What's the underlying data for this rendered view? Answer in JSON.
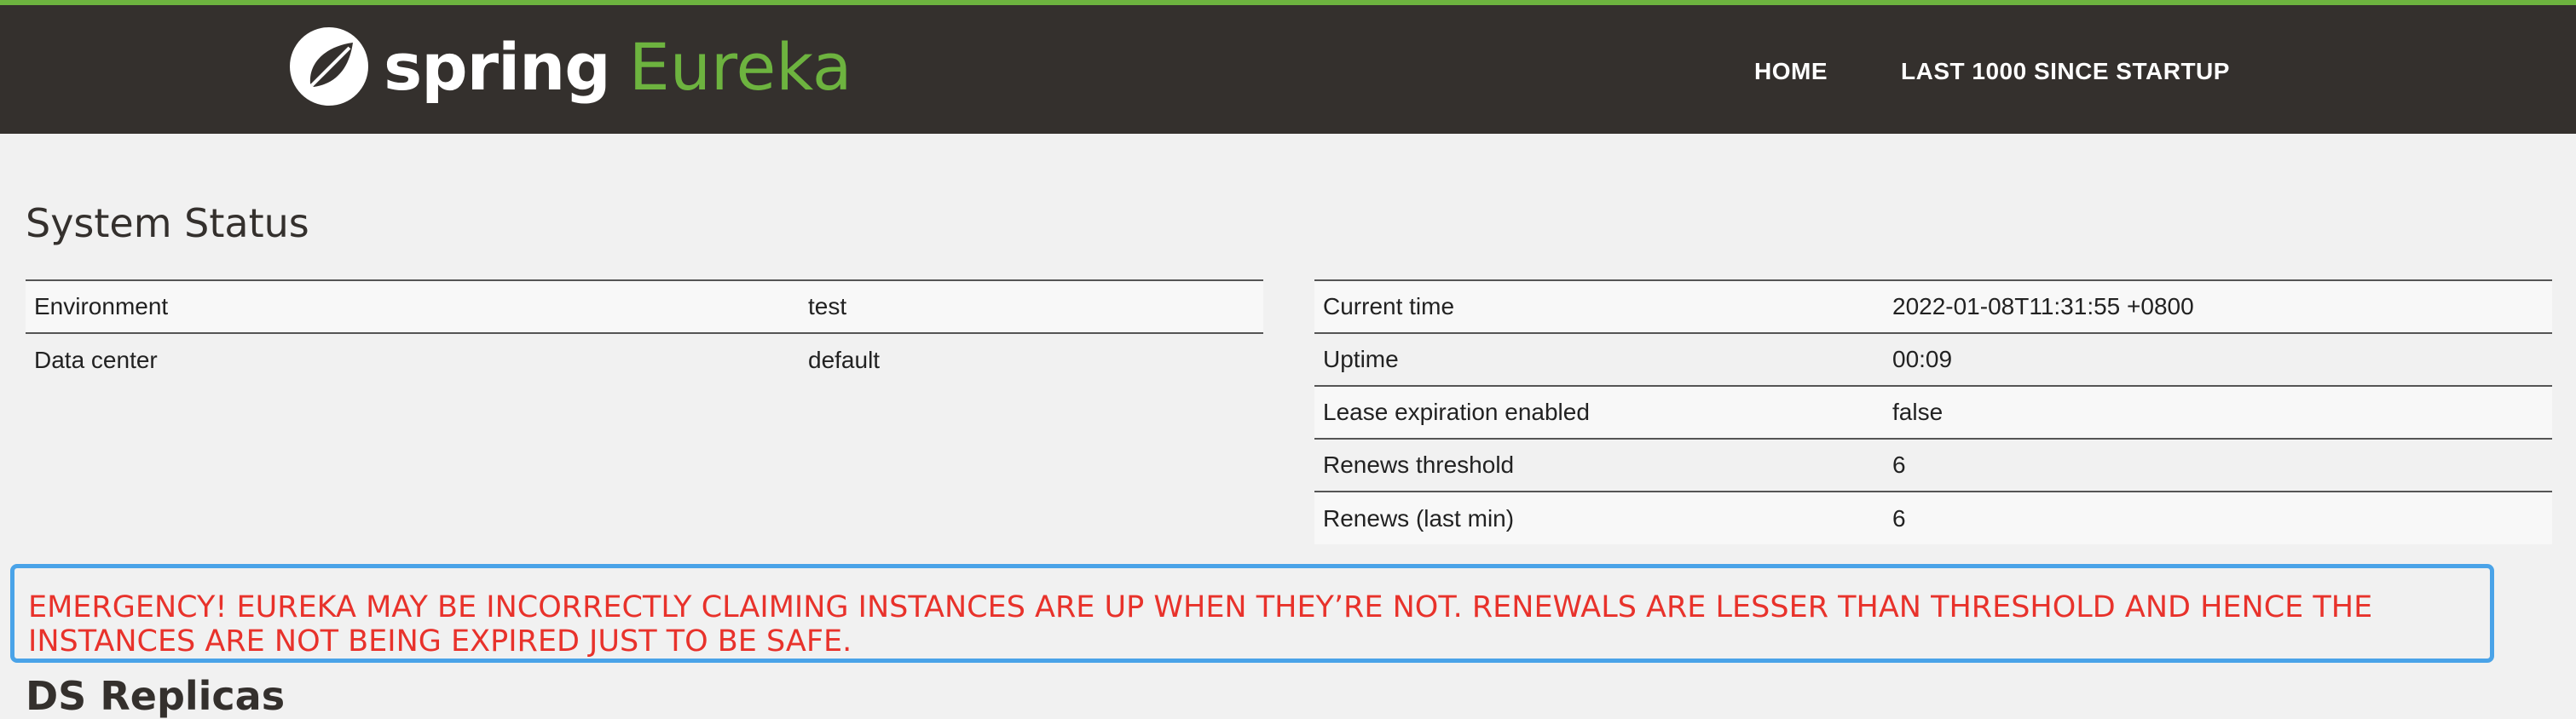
{
  "brand": {
    "spring": "spring",
    "eureka": "Eureka"
  },
  "nav": {
    "home": "HOME",
    "last1000": "LAST 1000 SINCE STARTUP"
  },
  "system_status": {
    "title": "System Status",
    "left_rows": [
      {
        "key": "Environment",
        "value": "test"
      },
      {
        "key": "Data center",
        "value": "default"
      }
    ],
    "right_rows": [
      {
        "key": "Current time",
        "value": "2022-01-08T11:31:55 +0800"
      },
      {
        "key": "Uptime",
        "value": "00:09"
      },
      {
        "key": "Lease expiration enabled",
        "value": "false"
      },
      {
        "key": "Renews threshold",
        "value": "6"
      },
      {
        "key": "Renews (last min)",
        "value": "6"
      }
    ]
  },
  "alert": {
    "message": "EMERGENCY! EUREKA MAY BE INCORRECTLY CLAIMING INSTANCES ARE UP WHEN THEY’RE NOT. RENEWALS ARE LESSER THAN THRESHOLD AND HENCE THE INSTANCES ARE NOT BEING EXPIRED JUST TO BE SAFE."
  },
  "next_section": {
    "title": "DS Replicas"
  },
  "colors": {
    "header_bg": "#34302d",
    "accent_green": "#6db33f",
    "alert_red": "#e8322b",
    "alert_border": "#4aa3e8"
  }
}
